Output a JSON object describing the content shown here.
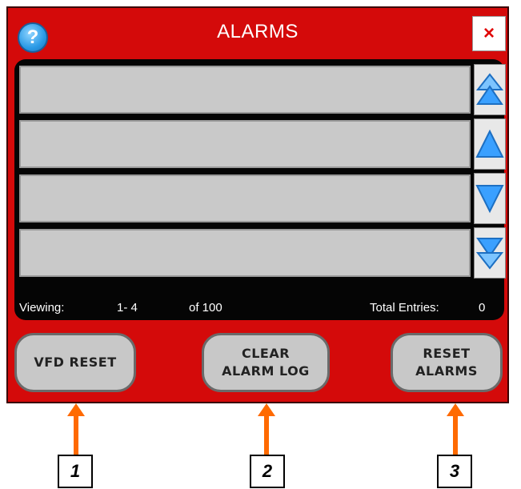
{
  "window": {
    "title": "ALARMS",
    "help_icon": "?",
    "close_icon": "×"
  },
  "alarm_list": {
    "rows": [
      "",
      "",
      "",
      ""
    ],
    "scroll_icons": [
      "double-up-arrow-icon",
      "up-arrow-icon",
      "down-arrow-icon",
      "double-down-arrow-icon"
    ]
  },
  "status": {
    "viewing_label": "Viewing:",
    "range": "1- 4",
    "of_total": "of 100",
    "total_label": "Total Entries:",
    "total_value": "0"
  },
  "buttons": {
    "vfd_reset": "VFD RESET",
    "clear_alarm_log_line1": "CLEAR",
    "clear_alarm_log_line2": "ALARM LOG",
    "reset_alarms_line1": "RESET",
    "reset_alarms_line2": "ALARMS"
  },
  "callouts": [
    "1",
    "2",
    "3"
  ],
  "colors": {
    "panel_red": "#d40a0a",
    "list_black": "#050505",
    "row_gray": "#c9c9c9",
    "arrow_orange": "#ff6a00",
    "scroll_blue": "#3aa0ff"
  }
}
